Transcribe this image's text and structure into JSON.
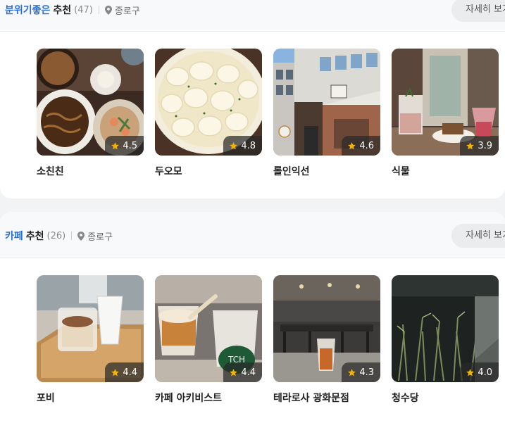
{
  "sections": [
    {
      "accent": "분위기좋은",
      "title": "추천",
      "count": "(47)",
      "location": "종로구",
      "more_label": "자세히 보기",
      "items": [
        {
          "name": "소친친",
          "rating": "4.5"
        },
        {
          "name": "두오모",
          "rating": "4.8"
        },
        {
          "name": "롤인익선",
          "rating": "4.6"
        },
        {
          "name": "식물",
          "rating": "3.9"
        }
      ]
    },
    {
      "accent": "카페",
      "title": "추천",
      "count": "(26)",
      "location": "종로구",
      "more_label": "자세히 보기",
      "items": [
        {
          "name": "포비",
          "rating": "4.4"
        },
        {
          "name": "카페 아키비스트",
          "rating": "4.4"
        },
        {
          "name": "테라로사 광화문점",
          "rating": "4.3"
        },
        {
          "name": "청수당",
          "rating": "4.0"
        }
      ]
    }
  ],
  "icons": {
    "location": "map-pin-icon",
    "rating": "star-icon"
  },
  "colors": {
    "accent": "#2b6fd6",
    "star": "#f5b301",
    "page_bg": "#f2f3f5"
  }
}
